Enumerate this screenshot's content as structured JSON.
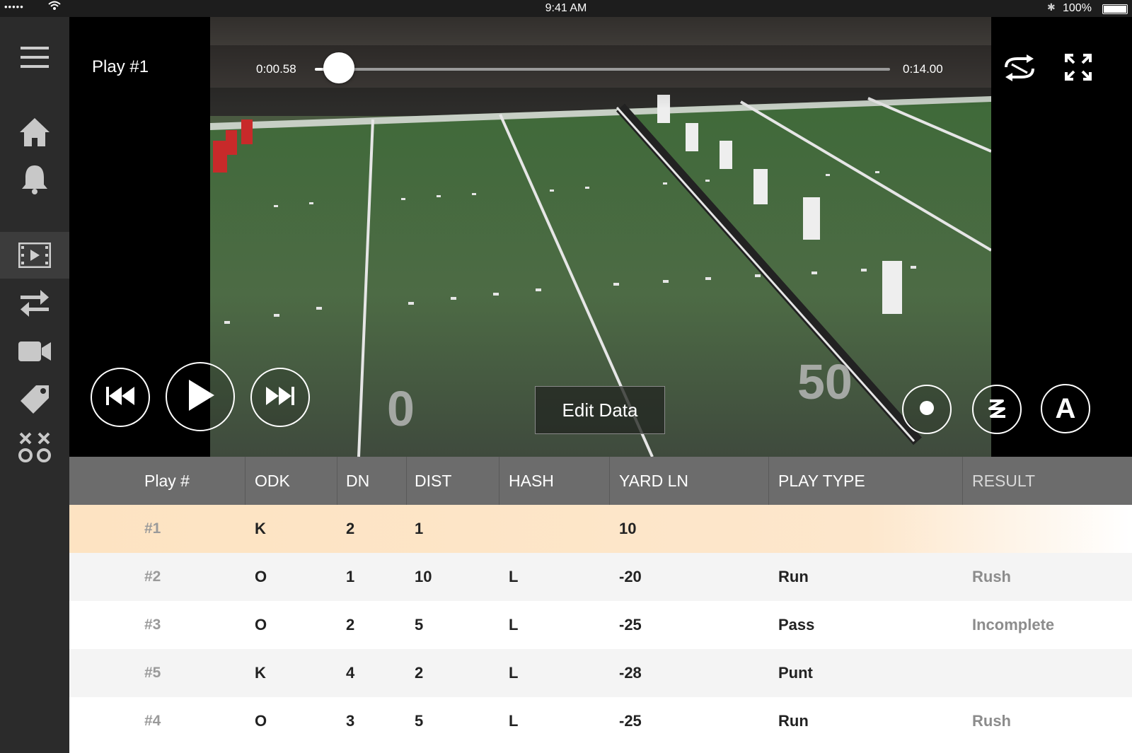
{
  "status_bar": {
    "signal": "•••••",
    "time": "9:41 AM",
    "battery": "100%"
  },
  "sidebar": {
    "items": [
      {
        "icon": "menu-icon"
      },
      {
        "icon": "home-icon"
      },
      {
        "icon": "bell-icon"
      },
      {
        "icon": "film-icon",
        "active": true
      },
      {
        "icon": "swap-arrows-icon"
      },
      {
        "icon": "video-camera-icon"
      },
      {
        "icon": "tag-icon"
      },
      {
        "icon": "xo-playbook-icon"
      }
    ]
  },
  "player": {
    "title": "Play #1",
    "current_time": "0:00.58",
    "duration": "0:14.00",
    "progress": 0.042,
    "edit_button": "Edit Data",
    "draw_tool_label": "A"
  },
  "table": {
    "headers": [
      "Play #",
      "ODK",
      "DN",
      "DIST",
      "HASH",
      "YARD LN",
      "PLAY TYPE",
      "RESULT"
    ],
    "rows": [
      [
        "#1",
        "K",
        "2",
        "1",
        "",
        "10",
        "",
        ""
      ],
      [
        "#2",
        "O",
        "1",
        "10",
        "L",
        "-20",
        "Run",
        "Rush"
      ],
      [
        "#3",
        "O",
        "2",
        "5",
        "L",
        "-25",
        "Pass",
        "Incomplete"
      ],
      [
        "#5",
        "K",
        "4",
        "2",
        "L",
        "-28",
        "Punt",
        ""
      ],
      [
        "#4",
        "O",
        "3",
        "5",
        "L",
        "-25",
        "Run",
        "Rush"
      ]
    ],
    "selected_row": 0
  }
}
